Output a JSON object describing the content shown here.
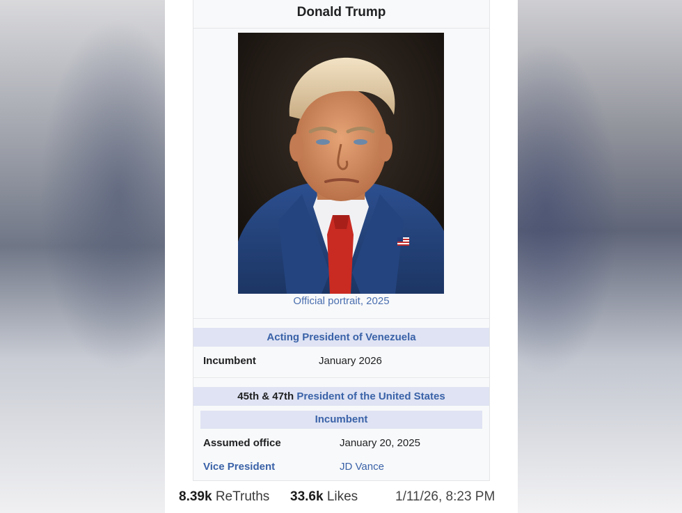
{
  "infobox": {
    "title": "Donald Trump",
    "portrait_alt": "Official portrait of Donald Trump",
    "caption": "Official portrait, 2025",
    "section1": {
      "header": "Acting President of Venezuela",
      "row_label": "Incumbent",
      "row_value": "January 2026"
    },
    "section2": {
      "header_prefix": "45th & 47th",
      "header_link": "President of the United States",
      "subheader": "Incumbent",
      "rows": [
        {
          "label": "Assumed office",
          "value": "January 20, 2025"
        },
        {
          "label": "Vice President",
          "value": "JD Vance"
        }
      ]
    }
  },
  "footer": {
    "retruths_count": "8.39k",
    "retruths_label": "ReTruths",
    "likes_count": "33.6k",
    "likes_label": "Likes",
    "timestamp": "1/11/26, 8:23 PM"
  },
  "colors": {
    "link": "#3a62a8",
    "band": "#dfe3f3",
    "infobox_bg": "#f8f9fa"
  }
}
